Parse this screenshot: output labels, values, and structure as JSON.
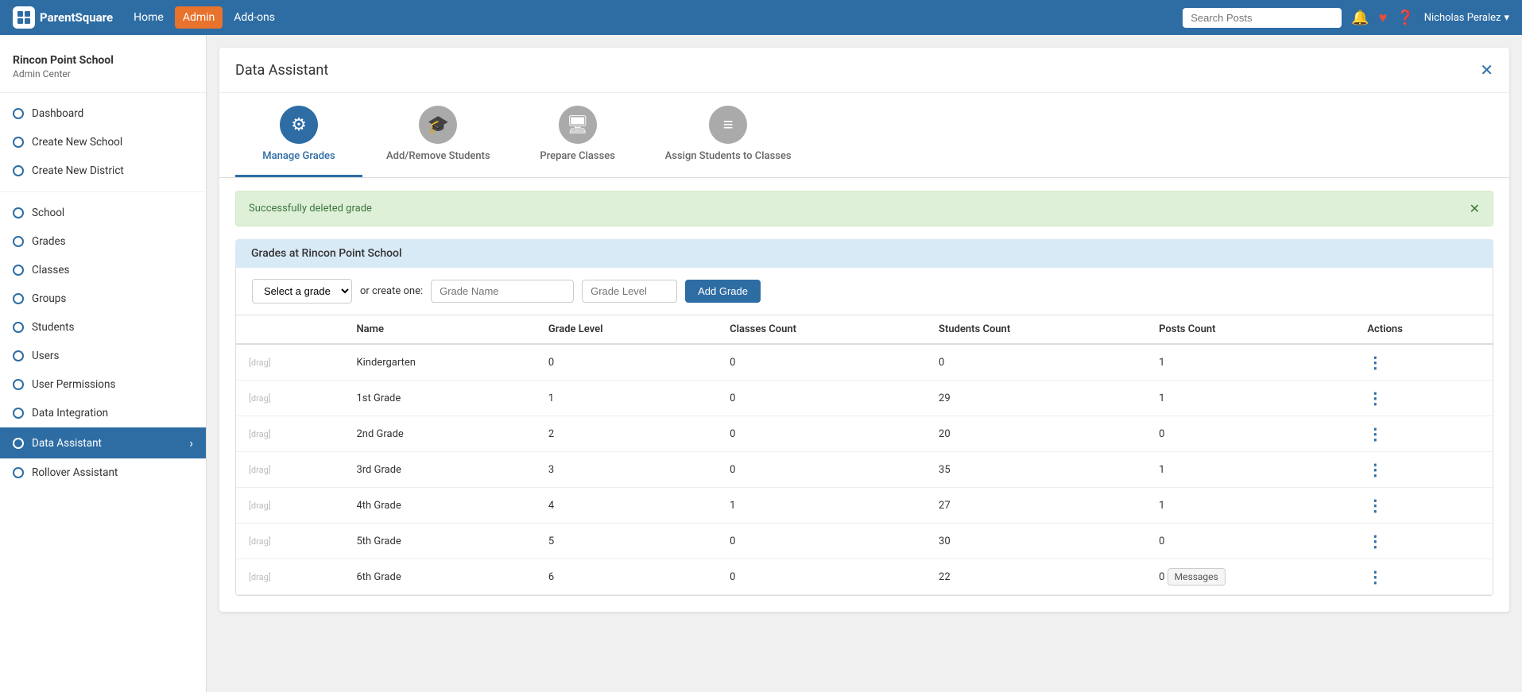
{
  "nav": {
    "logo_text": "ParentSquare",
    "links": [
      "Home",
      "Admin",
      "Add-ons"
    ],
    "active_link": "Admin",
    "search_placeholder": "Search Posts",
    "user_name": "Nicholas Peralez"
  },
  "sidebar": {
    "school_name": "Rincon Point School",
    "subtitle": "Admin Center",
    "items": [
      {
        "label": "Dashboard",
        "active": false
      },
      {
        "label": "Create New School",
        "active": false
      },
      {
        "label": "Create New District",
        "active": false
      },
      {
        "label": "School",
        "active": false
      },
      {
        "label": "Grades",
        "active": false
      },
      {
        "label": "Classes",
        "active": false
      },
      {
        "label": "Groups",
        "active": false
      },
      {
        "label": "Students",
        "active": false
      },
      {
        "label": "Users",
        "active": false
      },
      {
        "label": "User Permissions",
        "active": false
      },
      {
        "label": "Data Integration",
        "active": false
      },
      {
        "label": "Data Assistant",
        "active": true
      },
      {
        "label": "Rollover Assistant",
        "active": false
      }
    ]
  },
  "panel": {
    "title": "Data Assistant",
    "tabs": [
      {
        "label": "Manage Grades",
        "icon": "⚙",
        "active": true
      },
      {
        "label": "Add/Remove Students",
        "icon": "🎓",
        "active": false
      },
      {
        "label": "Prepare Classes",
        "icon": "🖥",
        "active": false
      },
      {
        "label": "Assign Students to Classes",
        "icon": "≡",
        "active": false
      }
    ],
    "alert": "Successfully deleted grade",
    "section_title": "Grades at Rincon Point School",
    "form": {
      "select_placeholder": "Select a grade",
      "or_text": "or create one:",
      "grade_name_placeholder": "Grade Name",
      "grade_level_placeholder": "Grade Level",
      "add_button": "Add Grade"
    },
    "table": {
      "headers": [
        "",
        "Name",
        "Grade Level",
        "Classes Count",
        "Students Count",
        "Posts Count",
        "Actions"
      ],
      "rows": [
        {
          "drag": "[drag]",
          "name": "Kindergarten",
          "grade_level": "0",
          "classes_count": "0",
          "students_count": "0",
          "posts_count": "1"
        },
        {
          "drag": "[drag]",
          "name": "1st Grade",
          "grade_level": "1",
          "classes_count": "0",
          "students_count": "29",
          "posts_count": "1"
        },
        {
          "drag": "[drag]",
          "name": "2nd Grade",
          "grade_level": "2",
          "classes_count": "0",
          "students_count": "20",
          "posts_count": "0"
        },
        {
          "drag": "[drag]",
          "name": "3rd Grade",
          "grade_level": "3",
          "classes_count": "0",
          "students_count": "35",
          "posts_count": "1"
        },
        {
          "drag": "[drag]",
          "name": "4th Grade",
          "grade_level": "4",
          "classes_count": "1",
          "students_count": "27",
          "posts_count": "1"
        },
        {
          "drag": "[drag]",
          "name": "5th Grade",
          "grade_level": "5",
          "classes_count": "0",
          "students_count": "30",
          "posts_count": "0"
        },
        {
          "drag": "[drag]",
          "name": "6th Grade",
          "grade_level": "6",
          "classes_count": "0",
          "students_count": "22",
          "posts_count": "0",
          "tooltip": "Messages"
        }
      ]
    }
  }
}
